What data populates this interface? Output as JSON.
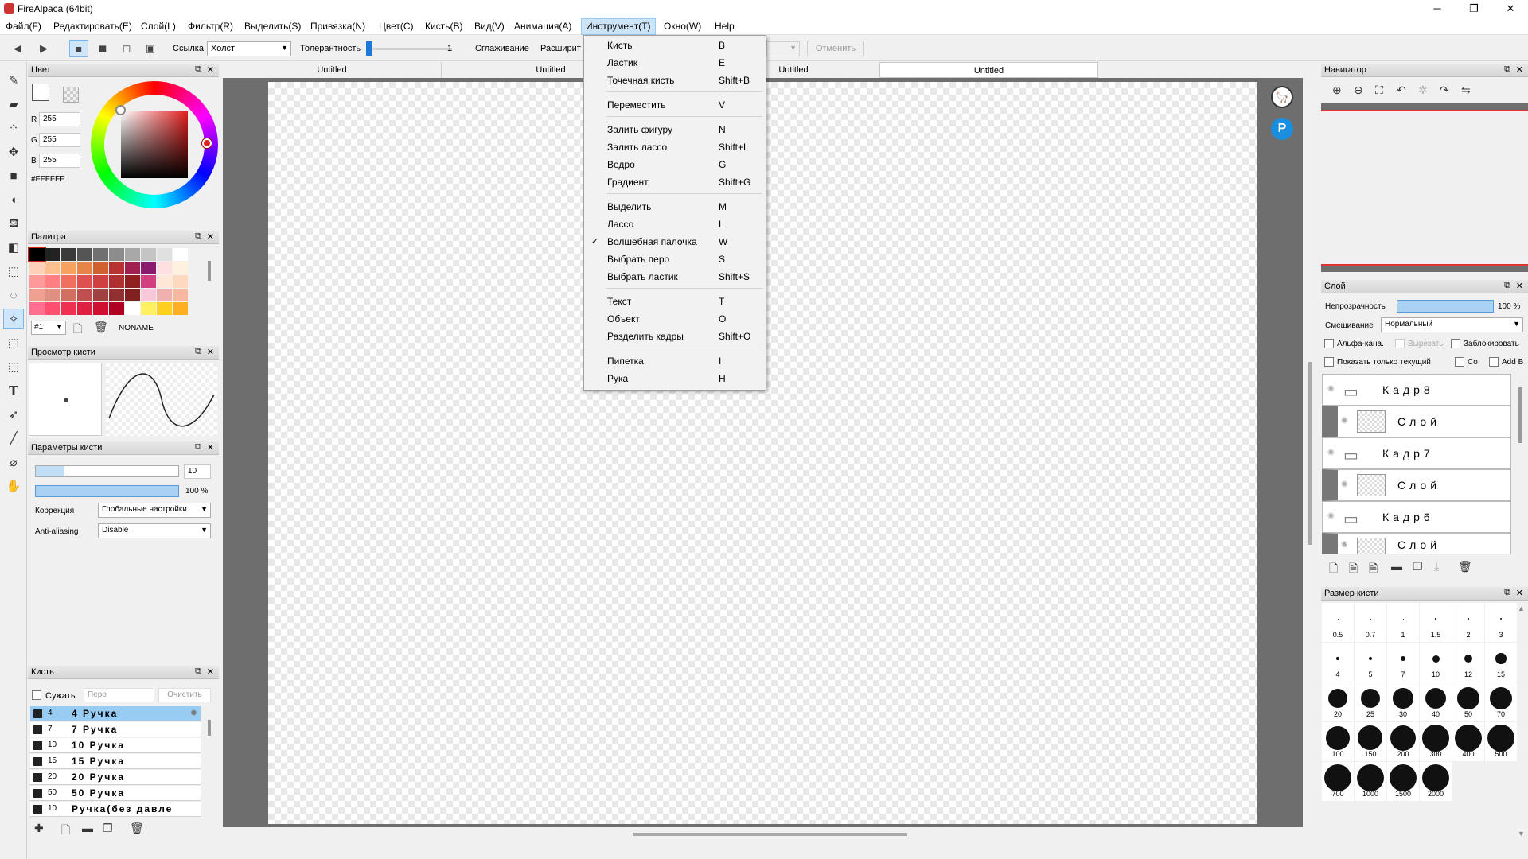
{
  "window": {
    "title": "FireAlpaca (64bit)",
    "minimize": "─",
    "maximize": "❐",
    "close": "✕"
  },
  "menu": [
    "Файл(F)",
    "Редактировать(E)",
    "Слой(L)",
    "Фильтр(R)",
    "Выделить(S)",
    "Привязка(N)",
    "Цвет(C)",
    "Кисть(B)",
    "Вид(V)",
    "Анимация(A)",
    "Инструмент(T)",
    "Окно(W)",
    "Help"
  ],
  "toolbar": {
    "ref_label": "Ссылка",
    "ref_value": "Холст",
    "tolerance_label": "Толерантность",
    "tolerance_value": "1",
    "smoothing_label": "Сглаживание",
    "expand_label": "Расширит",
    "cancel_label": "Отменить"
  },
  "tabs": [
    "Untitled",
    "Untitled",
    "Untitled",
    "Untitled"
  ],
  "color_panel": {
    "title": "Цвет",
    "r_label": "R",
    "r": "255",
    "g_label": "G",
    "g": "255",
    "b_label": "B",
    "b": "255",
    "hex": "#FFFFFF"
  },
  "palette_panel": {
    "title": "Палитра",
    "index": "#1",
    "name": "NONAME",
    "colors": [
      [
        "#000000",
        "#222222",
        "#3a3a3a",
        "#555555",
        "#707070",
        "#8c8c8c",
        "#a8a8a8",
        "#c4c4c4",
        "#e0e0e0",
        "#ffffff"
      ],
      [
        "#ffd0b8",
        "#ffc090",
        "#f6a25e",
        "#e8834a",
        "#d06030",
        "#b83232",
        "#a01e50",
        "#8a1a6e",
        "#ffe0e0",
        "#fff0e0"
      ],
      [
        "#ff9a9a",
        "#ff8080",
        "#f07060",
        "#e05050",
        "#d04040",
        "#b03030",
        "#902020",
        "#d04080",
        "#ffe8d8",
        "#ffd8c0"
      ],
      [
        "#f0a090",
        "#e09080",
        "#d07060",
        "#c05050",
        "#a04040",
        "#903030",
        "#802020",
        "#f8c8d8",
        "#f0b0b0",
        "#f8b8a0"
      ],
      [
        "#ff7090",
        "#ff5070",
        "#f03050",
        "#e02040",
        "#d01030",
        "#b00020",
        "#ffffff",
        "#fff060",
        "#ffd020",
        "#ffb020"
      ]
    ]
  },
  "brush_preview_panel": {
    "title": "Просмотр кисти"
  },
  "brush_params_panel": {
    "title": "Параметры кисти",
    "size_value": "10",
    "opacity_value": "100 %",
    "correction_label": "Коррекция",
    "correction_value": "Глобальные настройки",
    "aa_label": "Anti-aliasing",
    "aa_value": "Disable"
  },
  "brush_panel": {
    "title": "Кисть",
    "narrow_label": "Сужать",
    "filter_placeholder": "Перо",
    "clear_label": "Очистить",
    "items": [
      {
        "size": "4",
        "name": "4 Ручка"
      },
      {
        "size": "7",
        "name": "7 Ручка"
      },
      {
        "size": "10",
        "name": "10 Ручка"
      },
      {
        "size": "15",
        "name": "15 Ручка"
      },
      {
        "size": "20",
        "name": "20 Ручка"
      },
      {
        "size": "50",
        "name": "50 Ручка"
      },
      {
        "size": "10",
        "name": "Ручка(без давле"
      }
    ]
  },
  "tool_menu": {
    "groups": [
      [
        {
          "label": "Кисть",
          "shortcut": "B"
        },
        {
          "label": "Ластик",
          "shortcut": "E"
        },
        {
          "label": "Точечная кисть",
          "shortcut": "Shift+B"
        }
      ],
      [
        {
          "label": "Переместить",
          "shortcut": "V"
        }
      ],
      [
        {
          "label": "Залить фигуру",
          "shortcut": "N"
        },
        {
          "label": "Залить лассо",
          "shortcut": "Shift+L"
        },
        {
          "label": "Ведро",
          "shortcut": "G"
        },
        {
          "label": "Градиент",
          "shortcut": "Shift+G"
        }
      ],
      [
        {
          "label": "Выделить",
          "shortcut": "M"
        },
        {
          "label": "Лассо",
          "shortcut": "L"
        },
        {
          "label": "Волшебная палочка",
          "shortcut": "W",
          "checked": "✓"
        },
        {
          "label": "Выбрать перо",
          "shortcut": "S"
        },
        {
          "label": "Выбрать ластик",
          "shortcut": "Shift+S"
        }
      ],
      [
        {
          "label": "Текст",
          "shortcut": "T"
        },
        {
          "label": "Объект",
          "shortcut": "O"
        },
        {
          "label": "Разделить кадры",
          "shortcut": "Shift+O"
        }
      ],
      [
        {
          "label": "Пипетка",
          "shortcut": "I"
        },
        {
          "label": "Рука",
          "shortcut": "H"
        }
      ]
    ]
  },
  "navigator_panel": {
    "title": "Навигатор"
  },
  "layer_panel": {
    "title": "Слой",
    "opacity_label": "Непрозрачность",
    "opacity_value": "100 %",
    "blend_label": "Смешивание",
    "blend_value": "Нормальный",
    "alpha_label": "Альфа-кана.",
    "clip_label": "Вырезать",
    "lock_label": "Заблокировать",
    "show_current_label": "Показать только текущий",
    "co_label": "Со",
    "addb_label": "Add B",
    "layers": [
      {
        "type": "folder",
        "name": "Кадр8"
      },
      {
        "type": "layer",
        "name": "Слой"
      },
      {
        "type": "folder",
        "name": "Кадр7"
      },
      {
        "type": "layer",
        "name": "Слой"
      },
      {
        "type": "folder",
        "name": "Кадр6"
      },
      {
        "type": "layer",
        "name": "Слой"
      }
    ]
  },
  "brush_size_panel": {
    "title": "Размер кисти",
    "sizes": [
      "0.5",
      "0.7",
      "1",
      "1.5",
      "2",
      "3",
      "4",
      "5",
      "7",
      "10",
      "12",
      "15",
      "20",
      "25",
      "30",
      "40",
      "50",
      "70",
      "100",
      "150",
      "200",
      "300",
      "400",
      "500",
      "700",
      "1000",
      "1500",
      "2000"
    ],
    "size_values": [
      0.5,
      0.7,
      1,
      1.5,
      2,
      3,
      4,
      5,
      7,
      10,
      12,
      15,
      20,
      25,
      30,
      40,
      50,
      70,
      100,
      150,
      200,
      300,
      400,
      500,
      700,
      1000,
      1500,
      2000
    ]
  },
  "colors": {
    "accent": "#3b84d8",
    "selection": "#99ccf2",
    "canvas_bg": "#6e6e6e",
    "nav_line": "#e03030"
  }
}
